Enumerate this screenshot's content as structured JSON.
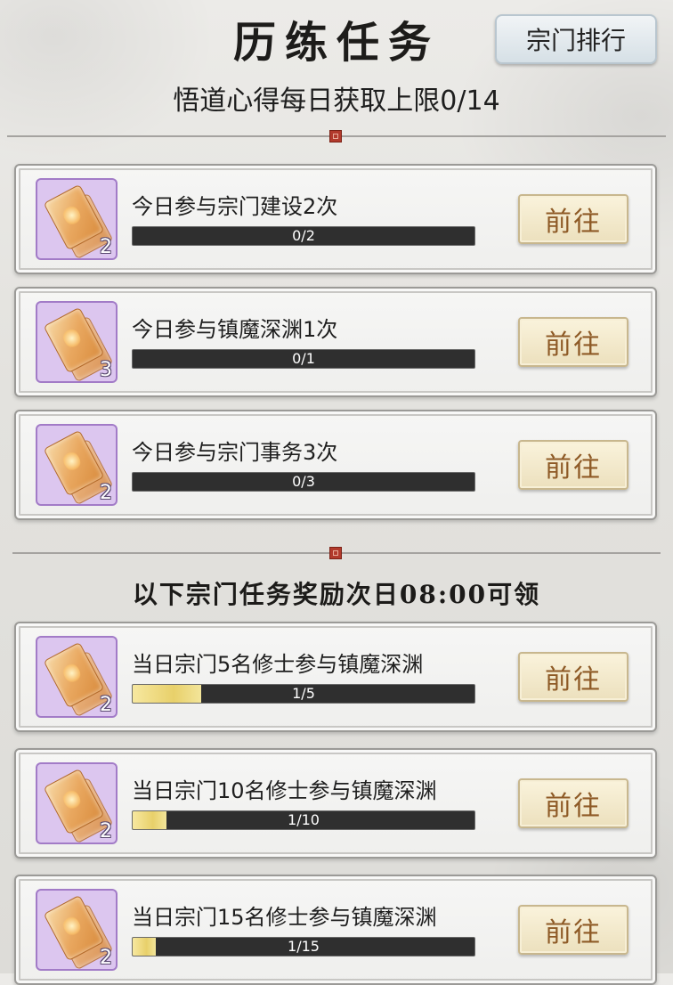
{
  "header": {
    "title": "历练任务",
    "rank_button_label": "宗门排行",
    "subtitle": "悟道心得每日获取上限0/14"
  },
  "section2_title": "以下宗门任务奖励次日08:00可领",
  "tasks": [
    {
      "text": "今日参与宗门建设2次",
      "count": "2",
      "progress_text": "0/2",
      "progress": 0.0,
      "button": "前往"
    },
    {
      "text": "今日参与镇魔深渊1次",
      "count": "3",
      "progress_text": "0/1",
      "progress": 0.0,
      "button": "前往"
    },
    {
      "text": "今日参与宗门事务3次",
      "count": "2",
      "progress_text": "0/3",
      "progress": 0.0,
      "button": "前往"
    }
  ],
  "sect_tasks": [
    {
      "text": "当日宗门5名修士参与镇魔深渊",
      "count": "2",
      "progress_text": "1/5",
      "progress": 0.2,
      "button": "前往"
    },
    {
      "text": "当日宗门10名修士参与镇魔深渊",
      "count": "2",
      "progress_text": "1/10",
      "progress": 0.1,
      "button": "前往"
    },
    {
      "text": "当日宗门15名修士参与镇魔深渊",
      "count": "2",
      "progress_text": "1/15",
      "progress": 0.067,
      "button": "前往"
    }
  ],
  "icons": {
    "reward_item": "scroll-icon",
    "seal": "seal-icon"
  },
  "colors": {
    "icon_bg": "#dcc6ef",
    "progress_fill": "#e8d06a",
    "button_text": "#8e5a26"
  }
}
